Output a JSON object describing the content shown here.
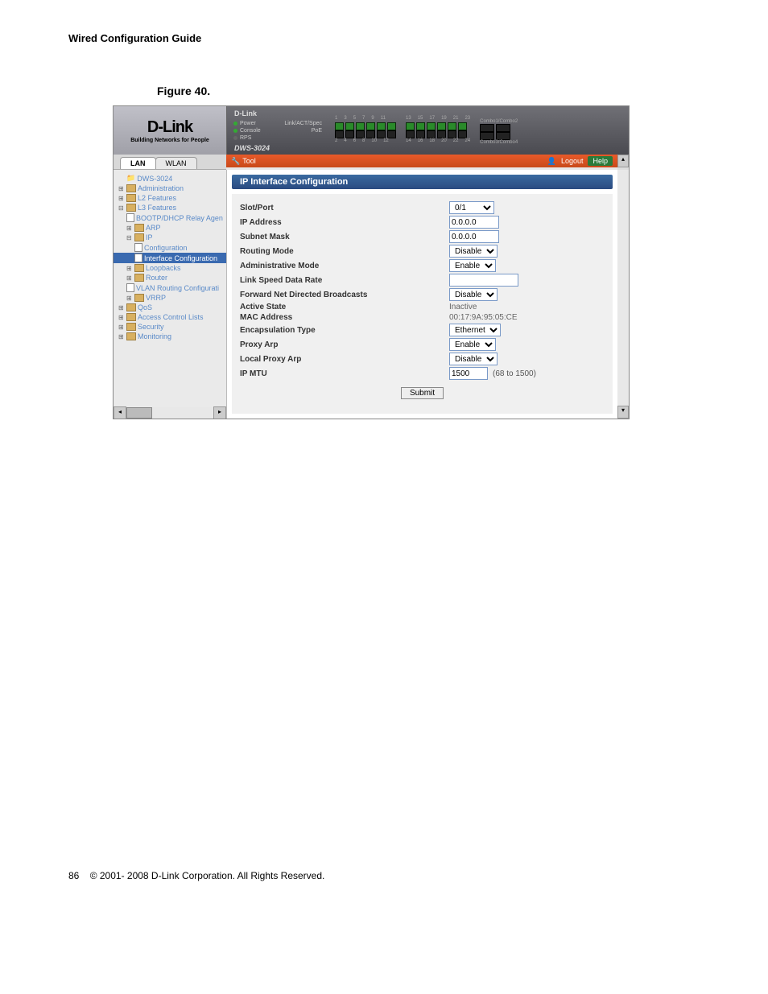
{
  "doc": {
    "header": "Wired Configuration Guide",
    "figure_label": "Figure 40.",
    "page_number": "86",
    "copyright": "© 2001- 2008 D-Link Corporation. All Rights Reserved."
  },
  "logo": {
    "brand": "D-Link",
    "tagline": "Building Networks for People",
    "mini": "D-Link",
    "device": "DWS-3024"
  },
  "status": {
    "items": [
      "Power",
      "Console",
      "RPS"
    ],
    "link": "Link/ACT/Spec",
    "poe": "PoE",
    "console_label": "Console"
  },
  "ports": {
    "top_labels_a": [
      "1",
      "3",
      "5",
      "7",
      "9",
      "11"
    ],
    "top_labels_b": [
      "13",
      "15",
      "17",
      "19",
      "21",
      "23"
    ],
    "bottom_labels_a": [
      "2",
      "4",
      "6",
      "8",
      "10",
      "12"
    ],
    "bottom_labels_b": [
      "14",
      "16",
      "18",
      "20",
      "22",
      "24"
    ],
    "combo1": "Combo1/Combo2",
    "combo2": "Combo3/Combo4"
  },
  "tabs": {
    "lan": "LAN",
    "wlan": "WLAN"
  },
  "tool": {
    "tool": "Tool",
    "logout": "Logout",
    "help": "Help"
  },
  "tree": {
    "root": "DWS-3024",
    "admin": "Administration",
    "l2": "L2 Features",
    "l3": "L3 Features",
    "bootp": "BOOTP/DHCP Relay Agen",
    "arp": "ARP",
    "ip": "IP",
    "config": "Configuration",
    "iface": "Interface Configuration",
    "loop": "Loopbacks",
    "router": "Router",
    "vlan": "VLAN Routing Configurati",
    "vrrp": "VRRP",
    "qos": "QoS",
    "acl": "Access Control Lists",
    "security": "Security",
    "monitoring": "Monitoring"
  },
  "panel": {
    "title": "IP Interface Configuration",
    "submit": "Submit"
  },
  "form": {
    "slot_port": {
      "label": "Slot/Port",
      "value": "0/1"
    },
    "ip_address": {
      "label": "IP Address",
      "value": "0.0.0.0"
    },
    "subnet": {
      "label": "Subnet Mask",
      "value": "0.0.0.0"
    },
    "routing": {
      "label": "Routing Mode",
      "value": "Disable"
    },
    "admin": {
      "label": "Administrative Mode",
      "value": "Enable"
    },
    "speed": {
      "label": "Link Speed Data Rate",
      "value": ""
    },
    "fwd": {
      "label": "Forward Net Directed Broadcasts",
      "value": "Disable"
    },
    "active": {
      "label": "Active State",
      "value": "Inactive"
    },
    "mac": {
      "label": "MAC Address",
      "value": "00:17:9A:95:05:CE"
    },
    "encap": {
      "label": "Encapsulation Type",
      "value": "Ethernet"
    },
    "proxy": {
      "label": "Proxy Arp",
      "value": "Enable"
    },
    "lproxy": {
      "label": "Local Proxy Arp",
      "value": "Disable"
    },
    "mtu": {
      "label": "IP MTU",
      "value": "1500",
      "hint": "(68 to 1500)"
    }
  }
}
